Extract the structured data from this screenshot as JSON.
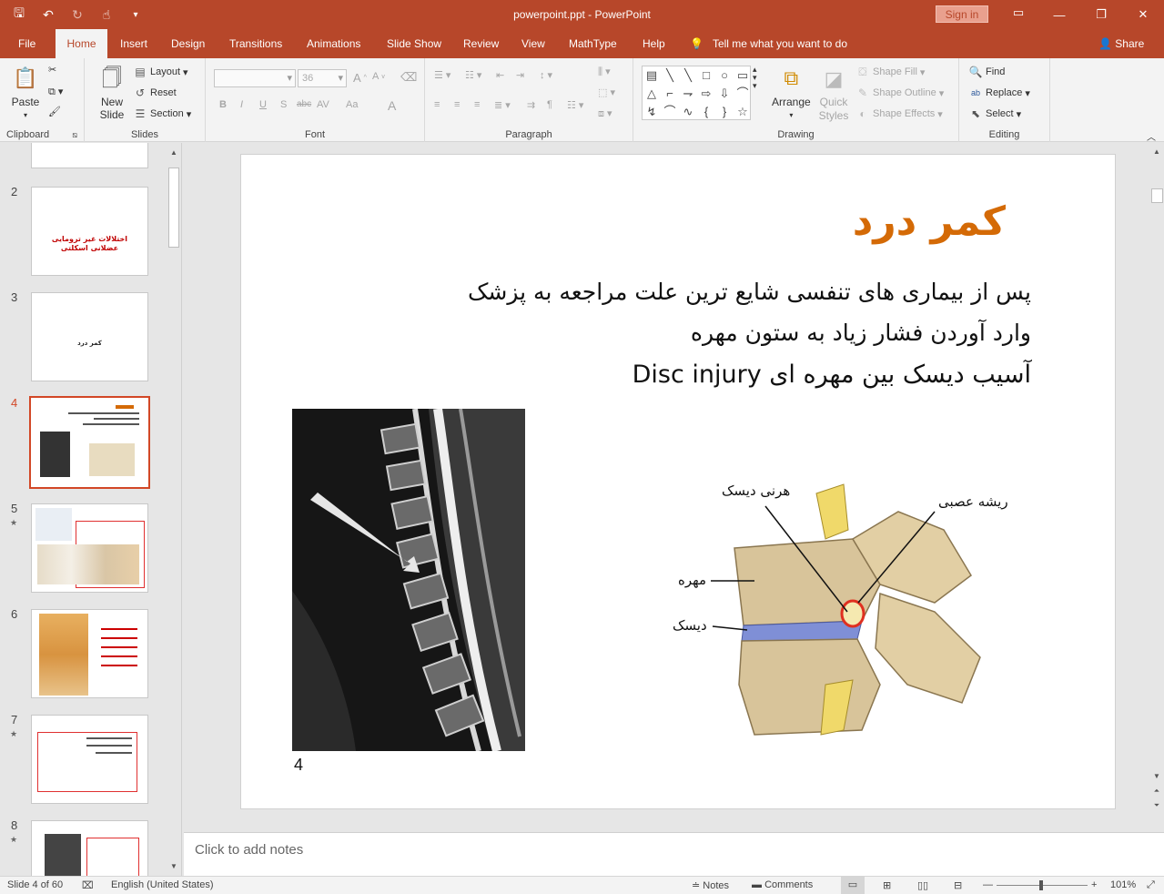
{
  "window": {
    "title": "powerpoint.ppt  -  PowerPoint",
    "sign_in": "Sign in",
    "controls": [
      "minimize",
      "restore",
      "close"
    ]
  },
  "qat": [
    "save-icon",
    "undo-icon",
    "redo-icon",
    "touch-mode-icon",
    "customize-icon"
  ],
  "tabs": [
    {
      "label": "File"
    },
    {
      "label": "Home"
    },
    {
      "label": "Insert"
    },
    {
      "label": "Design"
    },
    {
      "label": "Transitions"
    },
    {
      "label": "Animations"
    },
    {
      "label": "Slide Show"
    },
    {
      "label": "Review"
    },
    {
      "label": "View"
    },
    {
      "label": "MathType"
    },
    {
      "label": "Help"
    }
  ],
  "tell_me": "Tell me what you want to do",
  "share": "Share",
  "ribbon": {
    "clipboard": {
      "paste": "Paste",
      "label": "Clipboard"
    },
    "slides": {
      "new_slide": "New Slide",
      "layout": "Layout",
      "reset": "Reset",
      "section": "Section",
      "label": "Slides"
    },
    "font": {
      "size": "36",
      "label": "Font",
      "buttons": [
        "B",
        "I",
        "U",
        "S",
        "abc",
        "AV",
        "Aa",
        "A"
      ]
    },
    "paragraph": {
      "label": "Paragraph"
    },
    "drawing": {
      "arrange": "Arrange",
      "quick_styles": "Quick Styles",
      "shape_fill": "Shape Fill",
      "shape_outline": "Shape Outline",
      "shape_effects": "Shape Effects",
      "label": "Drawing"
    },
    "editing": {
      "find": "Find",
      "replace": "Replace",
      "select": "Select",
      "label": "Editing"
    }
  },
  "thumbnails": [
    {
      "num": "2",
      "star": false,
      "text": "اختلالات غیر ترومایی عضلانی اسکلتی"
    },
    {
      "num": "3",
      "star": false,
      "text": "کمر درد"
    },
    {
      "num": "4",
      "star": false,
      "selected": true
    },
    {
      "num": "5",
      "star": true
    },
    {
      "num": "6",
      "star": false
    },
    {
      "num": "7",
      "star": true
    },
    {
      "num": "8",
      "star": true
    }
  ],
  "slide": {
    "title": "کمر درد",
    "line1": "پس از بیماری های تنفسی شایع ترین علت مراجعه به پزشک",
    "line2": "وارد آوردن فشار زیاد به ستون مهره",
    "line3": "آسیب دیسک بین مهره ای  Disc injury",
    "mri_caption": "4",
    "spine_labels": {
      "herniated": "هرنی دیسک",
      "nerve_root": "ریشه عصبی",
      "vertebra": "مهره",
      "disc": "دیسک"
    }
  },
  "notes_placeholder": "Click to add notes",
  "status": {
    "slide_info": "Slide 4 of 60",
    "language": "English (United States)",
    "notes": "Notes",
    "comments": "Comments",
    "zoom": "101%"
  }
}
